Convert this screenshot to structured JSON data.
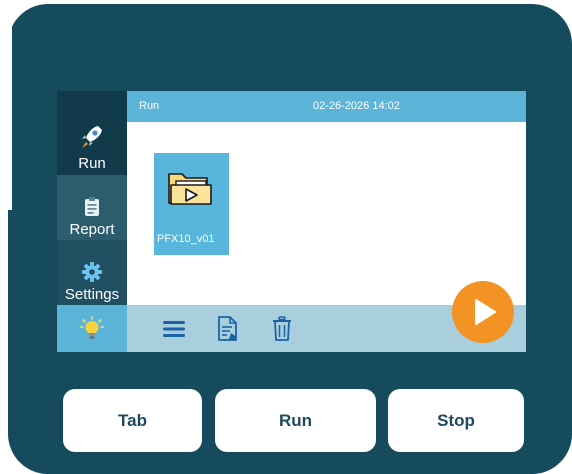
{
  "sidebar": {
    "items": [
      {
        "label": "Run",
        "icon": "rocket-icon"
      },
      {
        "label": "Report",
        "icon": "clipboard-icon"
      },
      {
        "label": "Settings",
        "icon": "gear-icon"
      },
      {
        "label": "",
        "icon": "lightbulb-icon"
      }
    ]
  },
  "header": {
    "title": "Run",
    "datetime": "02-26-2026 14:02"
  },
  "files": [
    {
      "name": "PFX10_v01",
      "icon": "video-folder-icon"
    }
  ],
  "toolbar": {
    "icons": [
      "menu-icon",
      "document-edit-icon",
      "trash-icon"
    ]
  },
  "play_button": {
    "icon": "play-icon"
  },
  "hardware_buttons": {
    "tab": "Tab",
    "run": "Run",
    "stop": "Stop"
  },
  "colors": {
    "device": "#164b5e",
    "accent": "#5cb4d8",
    "play": "#f39324",
    "toolbar": "#a9cedd"
  }
}
